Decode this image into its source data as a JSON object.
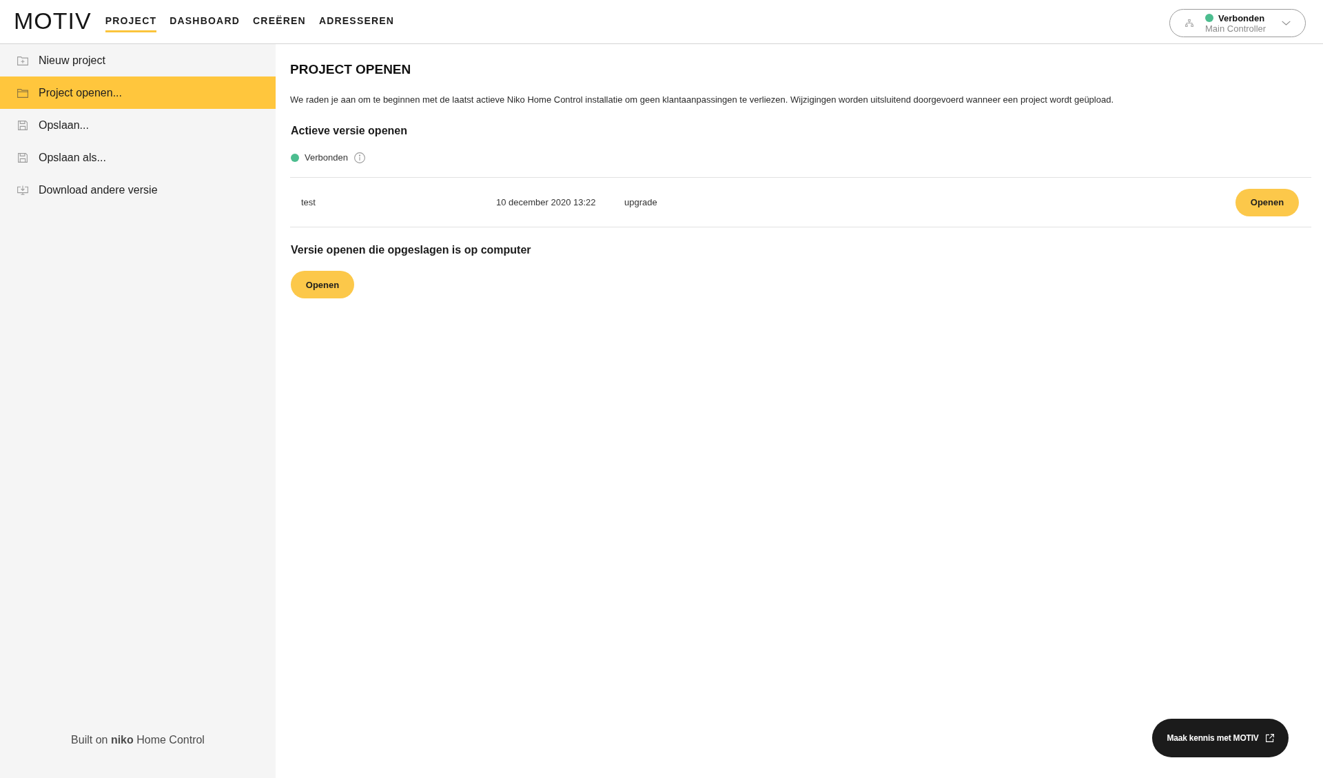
{
  "header": {
    "logo": "MOTIV",
    "nav": [
      {
        "label": "PROJECT",
        "selected": true
      },
      {
        "label": "DASHBOARD",
        "selected": false
      },
      {
        "label": "CREËREN",
        "selected": false
      },
      {
        "label": "ADRESSEREN",
        "selected": false
      }
    ],
    "connection": {
      "connected": true,
      "status": "Verbonden",
      "device": "Main Controller"
    }
  },
  "sidebar": {
    "items": [
      {
        "kind": "new",
        "label": "Nieuw project",
        "selected": false
      },
      {
        "kind": "open",
        "label": "Project openen...",
        "selected": true
      },
      {
        "kind": "save",
        "label": "Opslaan...",
        "selected": false
      },
      {
        "kind": "save",
        "label": "Opslaan als...",
        "selected": false
      },
      {
        "kind": "download",
        "label": "Download andere versie",
        "selected": false
      }
    ],
    "footer": "Built on **niko** Home Control"
  },
  "main": {
    "title": "PROJECT OPENEN",
    "intro": "We raden je aan om te beginnen met de laatst actieve Niko Home Control installatie om geen klantaanpassingen te verliezen. Wijzigingen worden uitsluitend doorgevoerd wanneer een project wordt geüpload.",
    "active_version": {
      "heading": "Actieve versie openen",
      "status": {
        "connected": true,
        "label": "Verbonden"
      },
      "rows": [
        {
          "cells": [
            "test",
            "10 december 2020 13:22",
            "upgrade"
          ],
          "action": "Openen"
        }
      ]
    },
    "local_version": {
      "heading": "Versie openen die opgeslagen is op computer",
      "action": "Openen"
    }
  },
  "promo_button": {
    "label": "Maak kennis met MOTIV"
  }
}
